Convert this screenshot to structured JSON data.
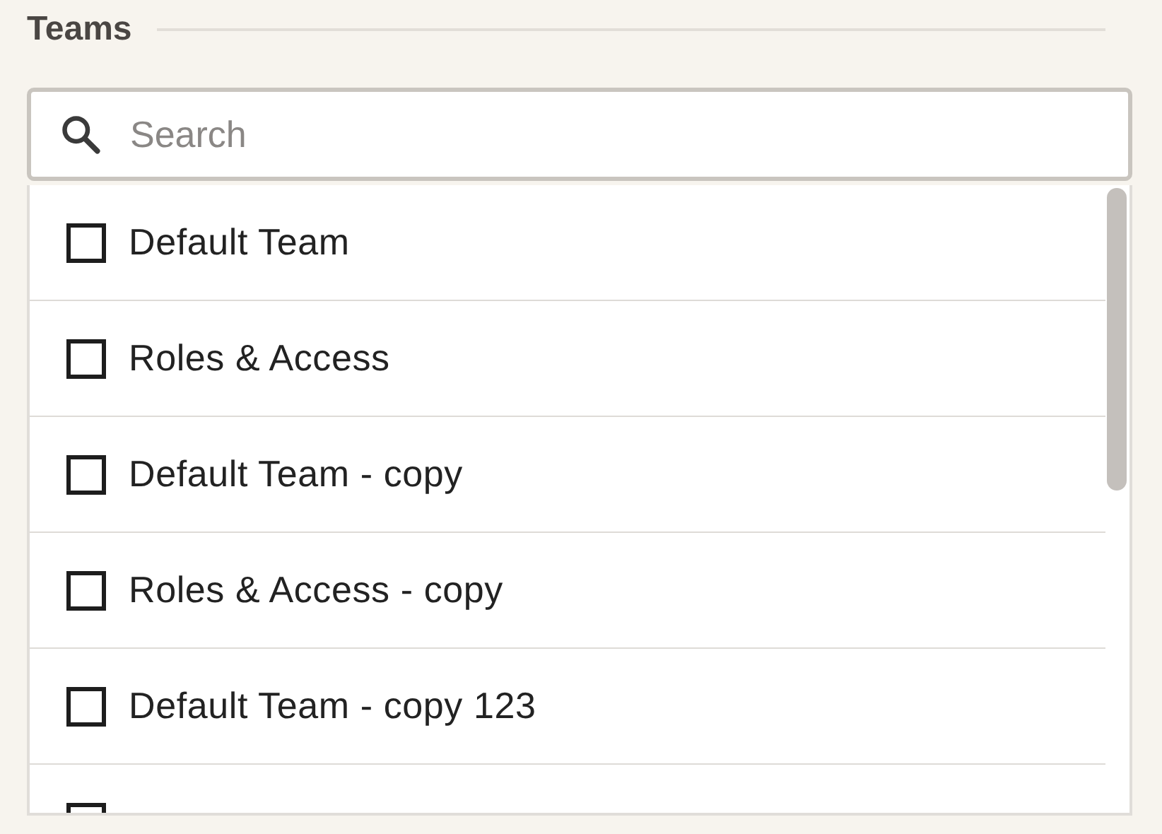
{
  "section": {
    "title": "Teams"
  },
  "search": {
    "placeholder": "Search"
  },
  "teams": [
    {
      "label": "Default Team",
      "checked": false
    },
    {
      "label": "Roles & Access",
      "checked": false
    },
    {
      "label": "Default Team - copy",
      "checked": false
    },
    {
      "label": "Roles & Access - copy",
      "checked": false
    },
    {
      "label": "Default Team - copy 123",
      "checked": false
    },
    {
      "checked": false
    }
  ]
}
